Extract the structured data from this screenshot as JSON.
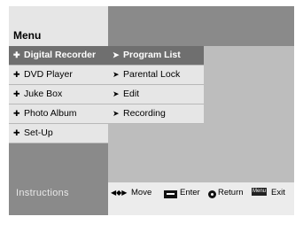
{
  "header": {
    "title": "Menu"
  },
  "main_menu": [
    {
      "label": "Digital Recorder",
      "icon": "plus-icon",
      "selected": true
    },
    {
      "label": "DVD Player",
      "icon": "plus-icon",
      "selected": false
    },
    {
      "label": "Juke Box",
      "icon": "plus-icon",
      "selected": false
    },
    {
      "label": "Photo Album",
      "icon": "plus-icon",
      "selected": false
    },
    {
      "label": "Set-Up",
      "icon": "plus-icon",
      "selected": false
    }
  ],
  "submenu": [
    {
      "label": "Program List",
      "icon": "arrow-icon",
      "selected": true
    },
    {
      "label": "Parental Lock",
      "icon": "arrow-icon",
      "selected": false
    },
    {
      "label": "Edit",
      "icon": "arrow-icon",
      "selected": false
    },
    {
      "label": "Recording",
      "icon": "arrow-icon",
      "selected": false
    }
  ],
  "instructions": {
    "title": "Instructions",
    "move_label": "Move",
    "enter_label": "Enter",
    "return_label": "Return",
    "menu_key": "Menu",
    "exit_label": "Exit"
  },
  "colors": {
    "selected_bg": "#6f6f6f",
    "item_bg": "#e6e6e6",
    "dark_panel": "#8a8a8a",
    "light_panel": "#bdbdbd"
  }
}
